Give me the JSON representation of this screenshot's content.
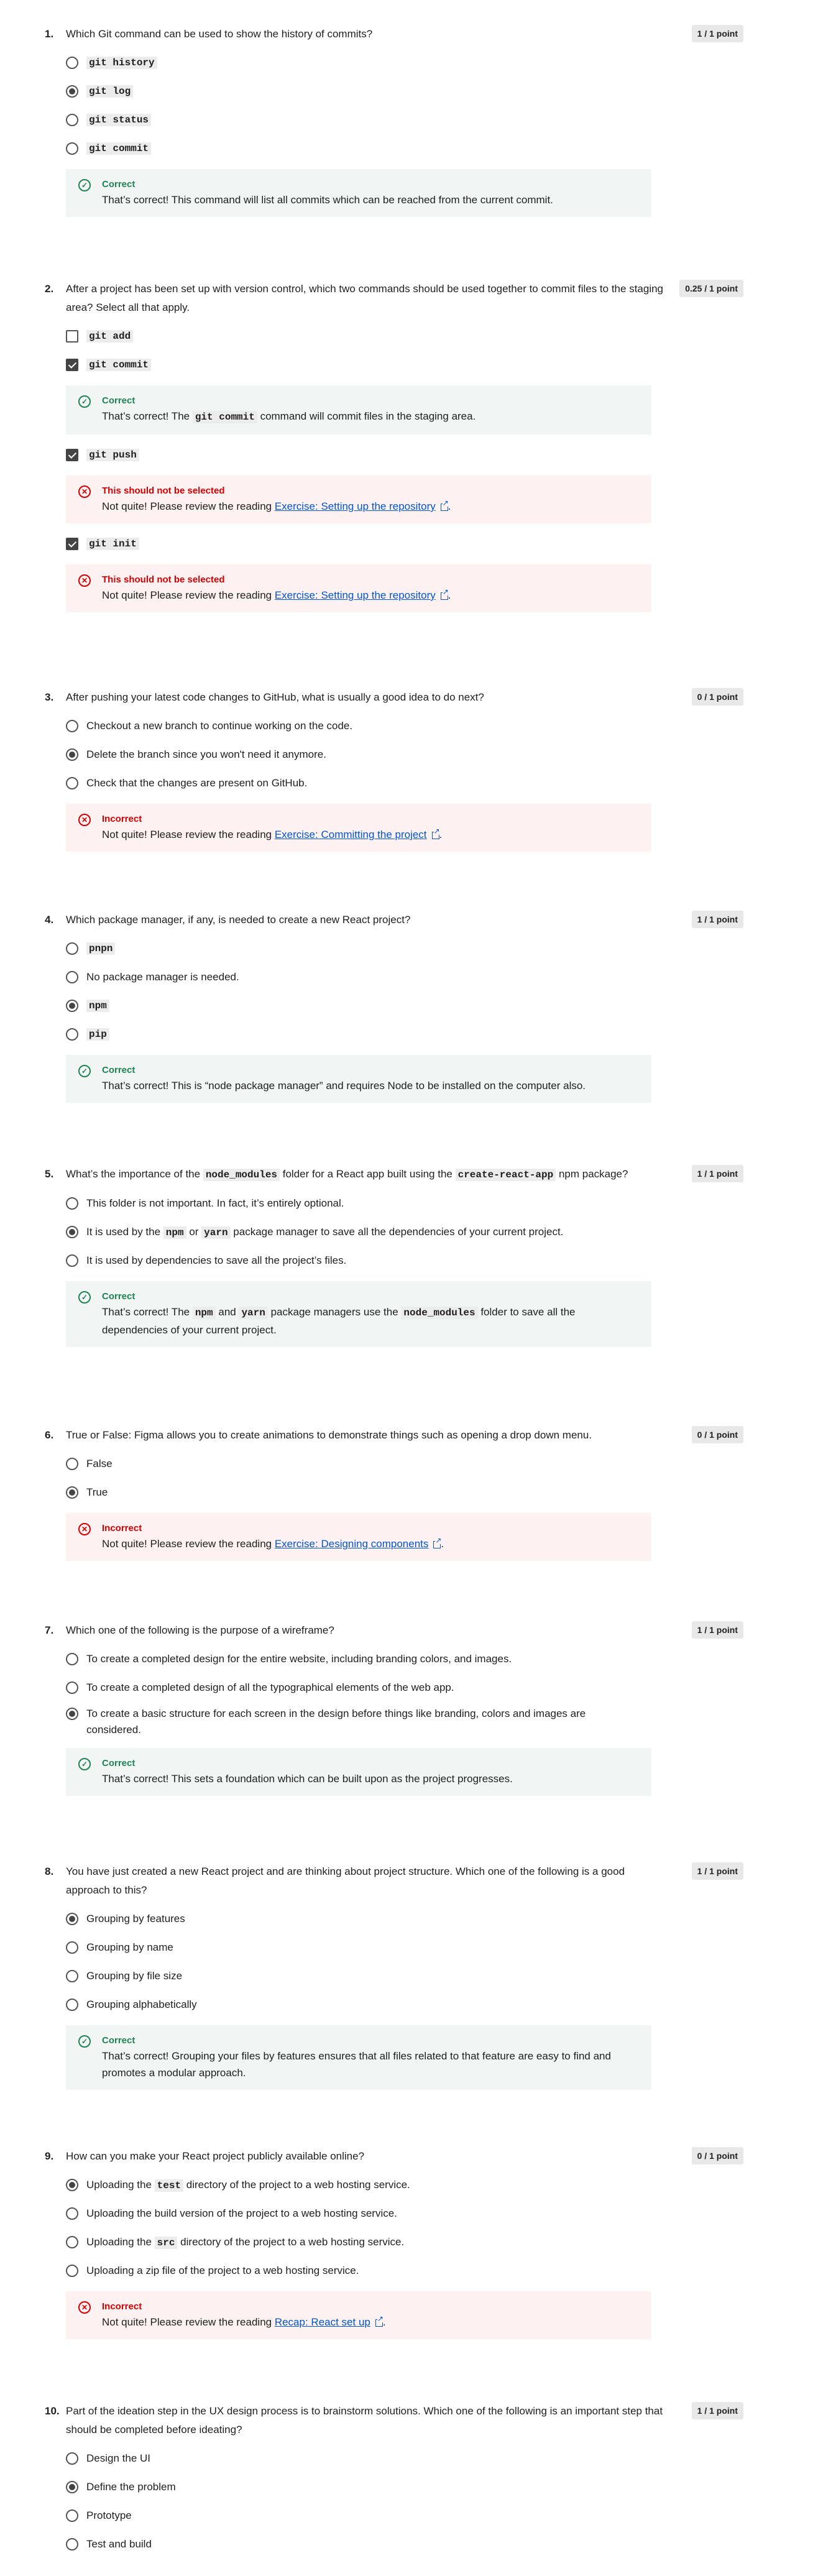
{
  "questions": [
    {
      "num": "1.",
      "text": "Which Git command can be used to show the history of commits?",
      "score": "1 / 1 point",
      "options": [
        {
          "label": "git history"
        },
        {
          "label": "git log"
        },
        {
          "label": "git status"
        },
        {
          "label": "git commit"
        }
      ],
      "feedback": {
        "title": "Correct",
        "body": "That’s correct! This command will list all commits which can be reached from the current commit."
      }
    },
    {
      "num": "2.",
      "text": "After a project has been set up with version control, which two commands should be used together to commit files to the staging area? Select all that apply.",
      "score": "0.25 / 1 point",
      "options": [
        {
          "label": "git add"
        },
        {
          "label": "git commit"
        },
        {
          "label": "git push"
        },
        {
          "label": "git init"
        }
      ],
      "feedback_commit": {
        "title": "Correct",
        "pre": "That’s correct! The ",
        "code": "git commit",
        "post": " command will commit files in the staging area."
      },
      "feedback_push": {
        "title": "This should not be selected",
        "pre": "Not quite! Please review the reading ",
        "link": "Exercise: Setting up the repository",
        "post": "."
      },
      "feedback_init": {
        "title": "This should not be selected",
        "pre": "Not quite! Please review the reading ",
        "link": "Exercise: Setting up the repository",
        "post": "."
      }
    },
    {
      "num": "3.",
      "text": "After pushing your latest code changes to GitHub, what is usually a good idea to do next?",
      "score": "0 / 1 point",
      "options": [
        {
          "label": "Checkout a new branch to continue working on the code."
        },
        {
          "label": "Delete the branch since you won't need it anymore."
        },
        {
          "label": "Check that the changes are present on GitHub."
        }
      ],
      "feedback": {
        "title": "Incorrect",
        "pre": "Not quite! Please review the reading ",
        "link": "Exercise: Committing the project",
        "post": "."
      }
    },
    {
      "num": "4.",
      "text": "Which package manager, if any, is needed to create a new React project?",
      "score": "1 / 1 point",
      "options": [
        {
          "label": "pnpn"
        },
        {
          "label": "No package manager is needed."
        },
        {
          "label": "npm"
        },
        {
          "label": "pip"
        }
      ],
      "feedback": {
        "title": "Correct",
        "body": "That’s correct! This is “node package manager” and requires Node to be installed on the computer also."
      }
    },
    {
      "num": "5.",
      "text_pre": "What’s the importance of the ",
      "text_code1": "node_modules",
      "text_mid": " folder for a React app built using the ",
      "text_code2": "create-react-app",
      "text_post": " npm package?",
      "score": "1 / 1 point",
      "options": [
        {
          "label": "This folder is not important. In fact, it’s entirely optional."
        },
        {
          "pre": "It is used by the ",
          "code1": "npm",
          "mid": " or ",
          "code2": "yarn",
          "post": " package manager to save all the dependencies of your current project."
        },
        {
          "label": "It is used by dependencies to save all the project’s files."
        }
      ],
      "feedback": {
        "title": "Correct",
        "pre": "That’s correct! The ",
        "code1": "npm",
        "mid1": " and ",
        "code2": "yarn",
        "mid2": " package managers use the ",
        "code3": "node_modules",
        "post": " folder to save all the dependencies of your current project."
      }
    },
    {
      "num": "6.",
      "text": "True or False: Figma allows you to create animations to demonstrate things such as opening a drop down menu.",
      "score": "0 / 1 point",
      "options": [
        {
          "label": "False"
        },
        {
          "label": "True"
        }
      ],
      "feedback": {
        "title": "Incorrect",
        "pre": "Not quite! Please review the reading ",
        "link": "Exercise: Designing components",
        "post": "."
      }
    },
    {
      "num": "7.",
      "text": "Which one of the following is the purpose of a wireframe?",
      "score": "1 / 1 point",
      "options": [
        {
          "label": "To create a completed design for the entire website, including branding colors, and images."
        },
        {
          "label": "To create a completed design of all the typographical elements of the web app."
        },
        {
          "label": "To create a basic structure for each screen in the design before things like branding, colors and images are considered."
        }
      ],
      "feedback": {
        "title": "Correct",
        "body": "That’s correct! This sets a foundation which can be built upon as the project progresses."
      }
    },
    {
      "num": "8.",
      "text": "You have just created a new React project and are thinking about project structure. Which one of the following is a good approach to this?",
      "score": "1 / 1 point",
      "options": [
        {
          "label": "Grouping by features"
        },
        {
          "label": "Grouping by name"
        },
        {
          "label": "Grouping by file size"
        },
        {
          "label": "Grouping alphabetically"
        }
      ],
      "feedback": {
        "title": "Correct",
        "body": "That’s correct! Grouping your files by features ensures that all files related to that feature are easy to find and promotes a modular approach."
      }
    },
    {
      "num": "9.",
      "text": "How can you make your React project publicly available online?",
      "score": "0 / 1 point",
      "options": [
        {
          "pre": "Uploading the ",
          "code": "test",
          "post": " directory of the project to a web hosting service."
        },
        {
          "label": "Uploading the build version of the project to a web hosting service."
        },
        {
          "pre": "Uploading the ",
          "code": "src",
          "post": " directory of the project to a web hosting service."
        },
        {
          "label": "Uploading a zip file of the project to a web hosting service."
        }
      ],
      "feedback": {
        "title": "Incorrect",
        "pre": "Not quite! Please review the reading ",
        "link": "Recap: React set up",
        "post": "."
      }
    },
    {
      "num": "10.",
      "text": "Part of the ideation step in the UX design process is to brainstorm solutions. Which one of the following is an important step that should be completed before ideating?",
      "score": "1 / 1 point",
      "options": [
        {
          "label": "Design the UI"
        },
        {
          "label": "Define the problem"
        },
        {
          "label": "Prototype"
        },
        {
          "label": "Test and build"
        }
      ]
    }
  ]
}
